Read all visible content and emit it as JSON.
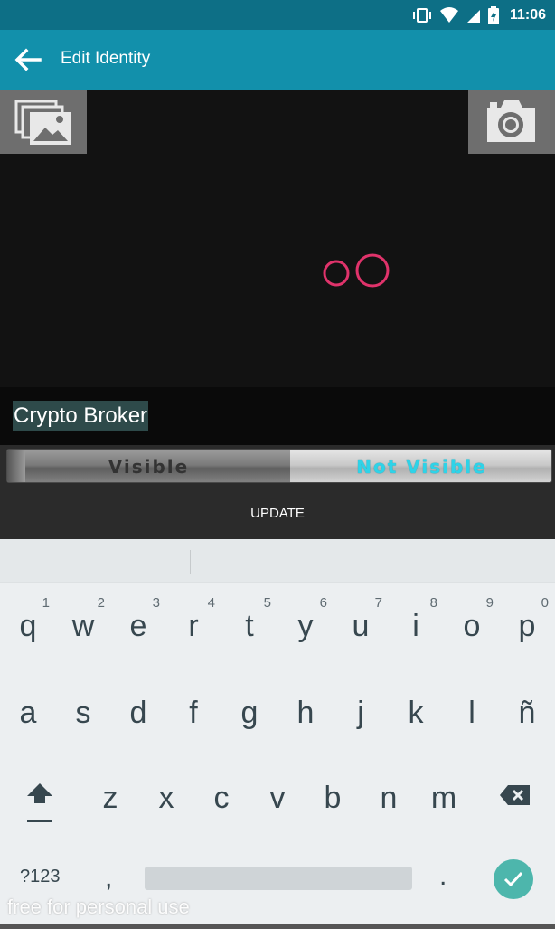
{
  "status_bar": {
    "time": "11:06"
  },
  "app_bar": {
    "title": "Edit Identity"
  },
  "photo_area": {
    "gallery_button": "gallery-icon",
    "camera_button": "camera-icon",
    "loading_indicator": "rings"
  },
  "identity": {
    "name": "Crypto Broker"
  },
  "visibility_toggle": {
    "left_label": "Visible",
    "right_label": "Not Visible",
    "selected": "Not Visible",
    "accent": "#2ed3e8"
  },
  "actions": {
    "update_label": "UPDATE"
  },
  "keyboard": {
    "row1": [
      {
        "key": "q",
        "hint": "1"
      },
      {
        "key": "w",
        "hint": "2"
      },
      {
        "key": "e",
        "hint": "3"
      },
      {
        "key": "r",
        "hint": "4"
      },
      {
        "key": "t",
        "hint": "5"
      },
      {
        "key": "y",
        "hint": "6"
      },
      {
        "key": "u",
        "hint": "7"
      },
      {
        "key": "i",
        "hint": "8"
      },
      {
        "key": "o",
        "hint": "9"
      },
      {
        "key": "p",
        "hint": "0"
      }
    ],
    "row2": [
      "a",
      "s",
      "d",
      "f",
      "g",
      "h",
      "j",
      "k",
      "l",
      "ñ"
    ],
    "row3": [
      "z",
      "x",
      "c",
      "v",
      "b",
      "n",
      "m"
    ],
    "symbols_label": "?123",
    "comma_label": ",",
    "period_label": "."
  },
  "watermark": "free for personal use",
  "colors": {
    "status_bar": "#0d6f86",
    "app_bar": "#1290ab",
    "enter_key": "#4db6ac"
  }
}
